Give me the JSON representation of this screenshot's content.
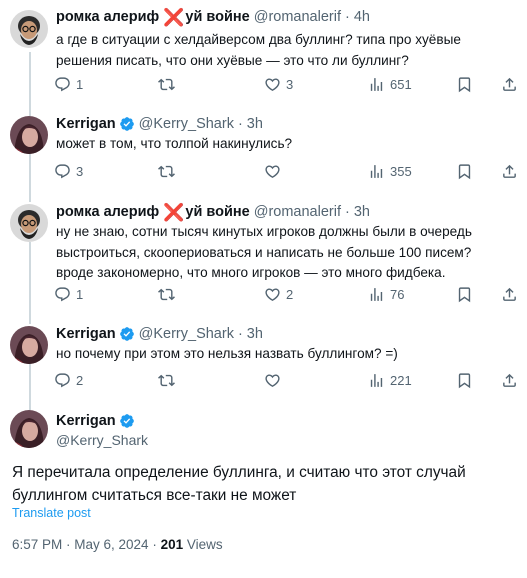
{
  "tweets": [
    {
      "name": "ромка алериф",
      "name_x": "❌",
      "name_suffix": "уй войне",
      "handle": "@romanalerif",
      "time": "4h",
      "text": "а где в ситуации с хелдайверсом два буллинг? типа про хуёвые решения писать, что они хуёвые — это что ли буллинг?",
      "replies": "1",
      "retweets": "",
      "likes": "3",
      "views": "651"
    },
    {
      "name": "Kerrigan",
      "handle": "@Kerry_Shark",
      "time": "3h",
      "text": "может в том, что толпой накинулись?",
      "replies": "3",
      "retweets": "",
      "likes": "",
      "views": "355"
    },
    {
      "name": "ромка алериф",
      "name_x": "❌",
      "name_suffix": "уй войне",
      "handle": "@romanalerif",
      "time": "3h",
      "text": "ну не знаю, сотни тысяч кинутых игроков должны были в очередь выстроиться, скоопериоваться и написать не больше 100 писем? вроде закономерно, что много игроков — это много фидбека.",
      "replies": "1",
      "retweets": "",
      "likes": "2",
      "views": "76"
    },
    {
      "name": "Kerrigan",
      "handle": "@Kerry_Shark",
      "time": "3h",
      "text": "но почему при этом это нельзя назвать буллингом? =)",
      "replies": "2",
      "retweets": "",
      "likes": "",
      "views": "221"
    }
  ],
  "main_tweet": {
    "name": "Kerrigan",
    "handle": "@Kerry_Shark",
    "text": "Я перечитала определение буллинга, и считаю что этот случай буллингом считаться все-таки не может",
    "translate": "Translate post",
    "datetime": "6:57 PM · May 6, 2024 · ",
    "views_count": "201",
    "views_label": " Views"
  },
  "separator_dot": "·",
  "colors": {
    "verified": "#1d9bf0",
    "link": "#1d9bf0",
    "muted": "#536471",
    "thread_line": "#cfd9de"
  },
  "icons": [
    "reply-icon",
    "retweet-icon",
    "like-icon",
    "views-icon",
    "bookmark-icon",
    "share-icon",
    "verified-badge-icon"
  ]
}
